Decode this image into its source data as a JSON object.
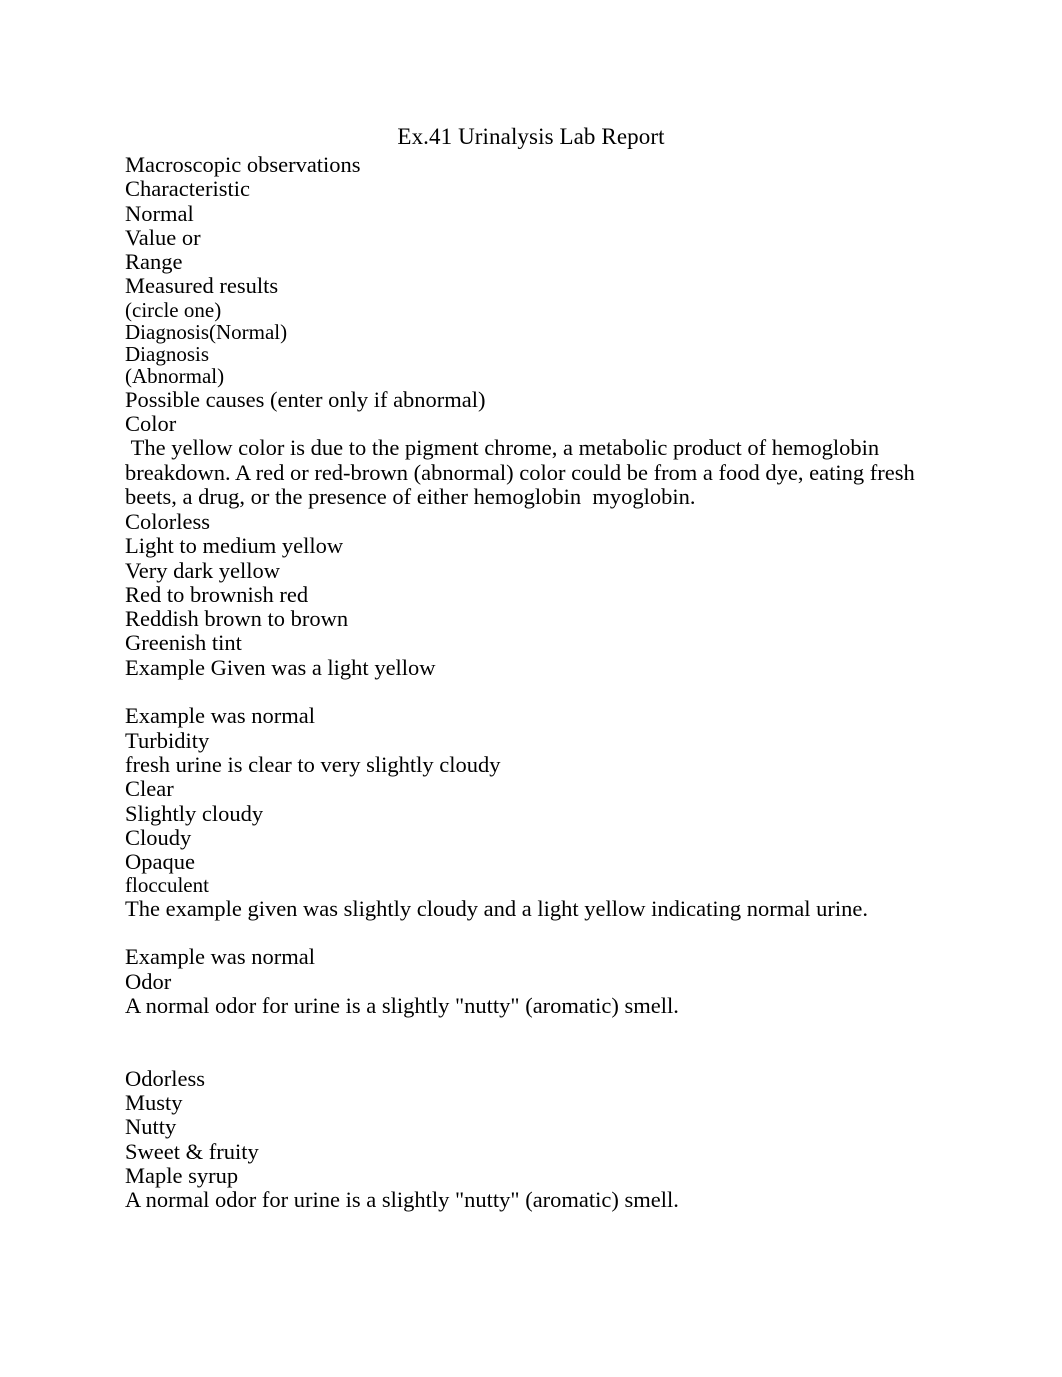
{
  "document": {
    "title": "Ex.41 Urinalysis Lab Report",
    "lines": [
      {
        "text": "Macroscopic observations",
        "style": "normal"
      },
      {
        "text": "Characteristic",
        "style": "normal"
      },
      {
        "text": "Normal",
        "style": "normal"
      },
      {
        "text": "Value or",
        "style": "normal"
      },
      {
        "text": "Range",
        "style": "normal"
      },
      {
        "text": "Measured results",
        "style": "normal"
      },
      {
        "text": "(circle one)",
        "style": "small"
      },
      {
        "text": "Diagnosis(Normal)",
        "style": "small"
      },
      {
        "text": "Diagnosis",
        "style": "small"
      },
      {
        "text": "(Abnormal)",
        "style": "small"
      },
      {
        "text": "Possible causes (enter only if abnormal)",
        "style": "normal"
      },
      {
        "text": "Color",
        "style": "normal"
      },
      {
        "text": " The yellow color is due to the pigment chrome, a metabolic product of hemoglobin breakdown. A red or red-brown (abnormal) color could be from a food dye, eating fresh beets, a drug, or the presence of either hemoglobin  myoglobin.",
        "style": "para"
      },
      {
        "text": "Colorless",
        "style": "normal"
      },
      {
        "text": "Light to medium yellow",
        "style": "normal"
      },
      {
        "text": "Very dark yellow",
        "style": "normal"
      },
      {
        "text": "Red to brownish red",
        "style": "normal"
      },
      {
        "text": "Reddish brown to brown",
        "style": "normal"
      },
      {
        "text": "Greenish tint",
        "style": "normal"
      },
      {
        "text": "Example Given was a light yellow",
        "style": "normal"
      },
      {
        "text": "",
        "style": "blank"
      },
      {
        "text": "Example was normal",
        "style": "normal"
      },
      {
        "text": "Turbidity",
        "style": "normal"
      },
      {
        "text": "fresh urine is clear to very slightly cloudy",
        "style": "normal"
      },
      {
        "text": "Clear",
        "style": "normal"
      },
      {
        "text": "Slightly cloudy",
        "style": "normal"
      },
      {
        "text": "Cloudy",
        "style": "normal"
      },
      {
        "text": "Opaque",
        "style": "normal"
      },
      {
        "text": "flocculent",
        "style": "small"
      },
      {
        "text": "The example given was slightly cloudy and a light yellow indicating normal urine.",
        "style": "normal"
      },
      {
        "text": "",
        "style": "blank"
      },
      {
        "text": "Example was normal",
        "style": "normal"
      },
      {
        "text": "Odor",
        "style": "normal"
      },
      {
        "text": "A normal odor for urine is a slightly \"nutty\" (aromatic) smell.",
        "style": "normal"
      },
      {
        "text": "",
        "style": "blank"
      },
      {
        "text": "",
        "style": "blank"
      },
      {
        "text": "Odorless",
        "style": "normal"
      },
      {
        "text": "Musty",
        "style": "normal"
      },
      {
        "text": "Nutty",
        "style": "normal"
      },
      {
        "text": "Sweet & fruity",
        "style": "normal"
      },
      {
        "text": "Maple syrup",
        "style": "normal"
      },
      {
        "text": "A normal odor for urine is a slightly \"nutty\" (aromatic) smell.",
        "style": "normal"
      }
    ]
  },
  "colors": {
    "page_background": "#ffffff",
    "text": "#000000"
  }
}
